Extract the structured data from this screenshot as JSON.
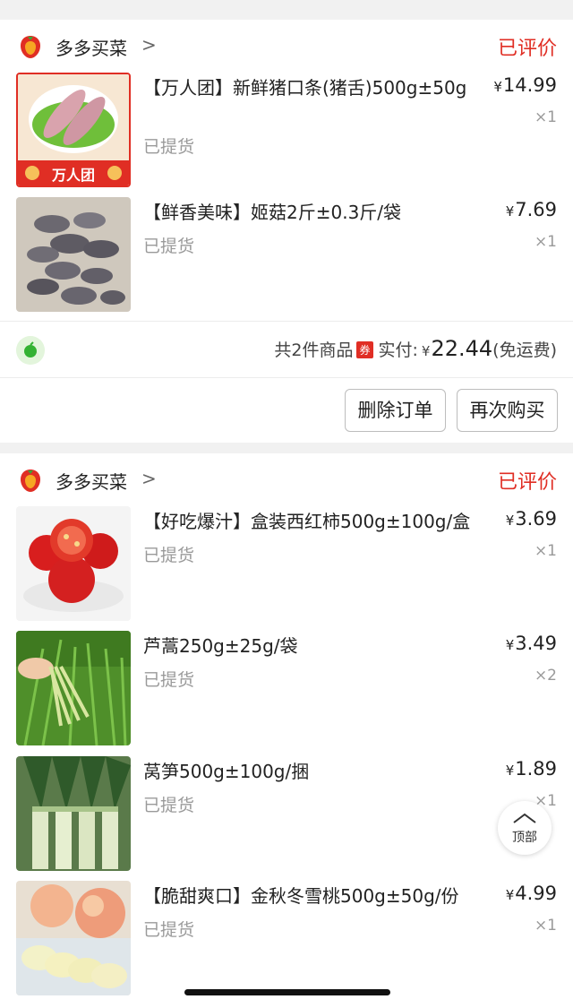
{
  "orders": [
    {
      "store_name": "多多买菜",
      "store_chevron": ">",
      "status": "已评价",
      "items": [
        {
          "title": "【万人团】新鲜猪口条(猪舌)500g±50g",
          "status": "已提货",
          "currency": "¥",
          "price": "14.99",
          "qty": "×1",
          "thumb": "pork-tongue",
          "badge": "万人团"
        },
        {
          "title": "【鲜香美味】姬菇2斤±0.3斤/袋",
          "status": "已提货",
          "currency": "¥",
          "price": "7.69",
          "qty": "×1",
          "thumb": "oyster-mushroom"
        }
      ],
      "summary": {
        "count_text": "共2件商品",
        "coupon": "券",
        "paid_label": "实付:",
        "currency": "¥",
        "amount": "22.44",
        "shipping": "(免运费)"
      },
      "buttons": {
        "delete": "删除订单",
        "rebuy": "再次购买"
      }
    },
    {
      "store_name": "多多买菜",
      "store_chevron": ">",
      "status": "已评价",
      "items": [
        {
          "title": "【好吃爆汁】盒装西红柿500g±100g/盒",
          "status": "已提货",
          "currency": "¥",
          "price": "3.69",
          "qty": "×1",
          "thumb": "tomato"
        },
        {
          "title": "芦蒿250g±25g/袋",
          "status": "已提货",
          "currency": "¥",
          "price": "3.49",
          "qty": "×2",
          "thumb": "artemisia"
        },
        {
          "title": "莴笋500g±100g/捆",
          "status": "已提货",
          "currency": "¥",
          "price": "1.89",
          "qty": "×1",
          "thumb": "lettuce-stem"
        },
        {
          "title": "【脆甜爽口】金秋冬雪桃500g±50g/份",
          "status": "已提货",
          "currency": "¥",
          "price": "4.99",
          "qty": "×1",
          "thumb": "peach"
        }
      ]
    }
  ],
  "back_to_top": "顶部",
  "colors": {
    "accent_red": "#e02e24",
    "muted": "#9a9a9a",
    "background": "#f1f1f1"
  }
}
